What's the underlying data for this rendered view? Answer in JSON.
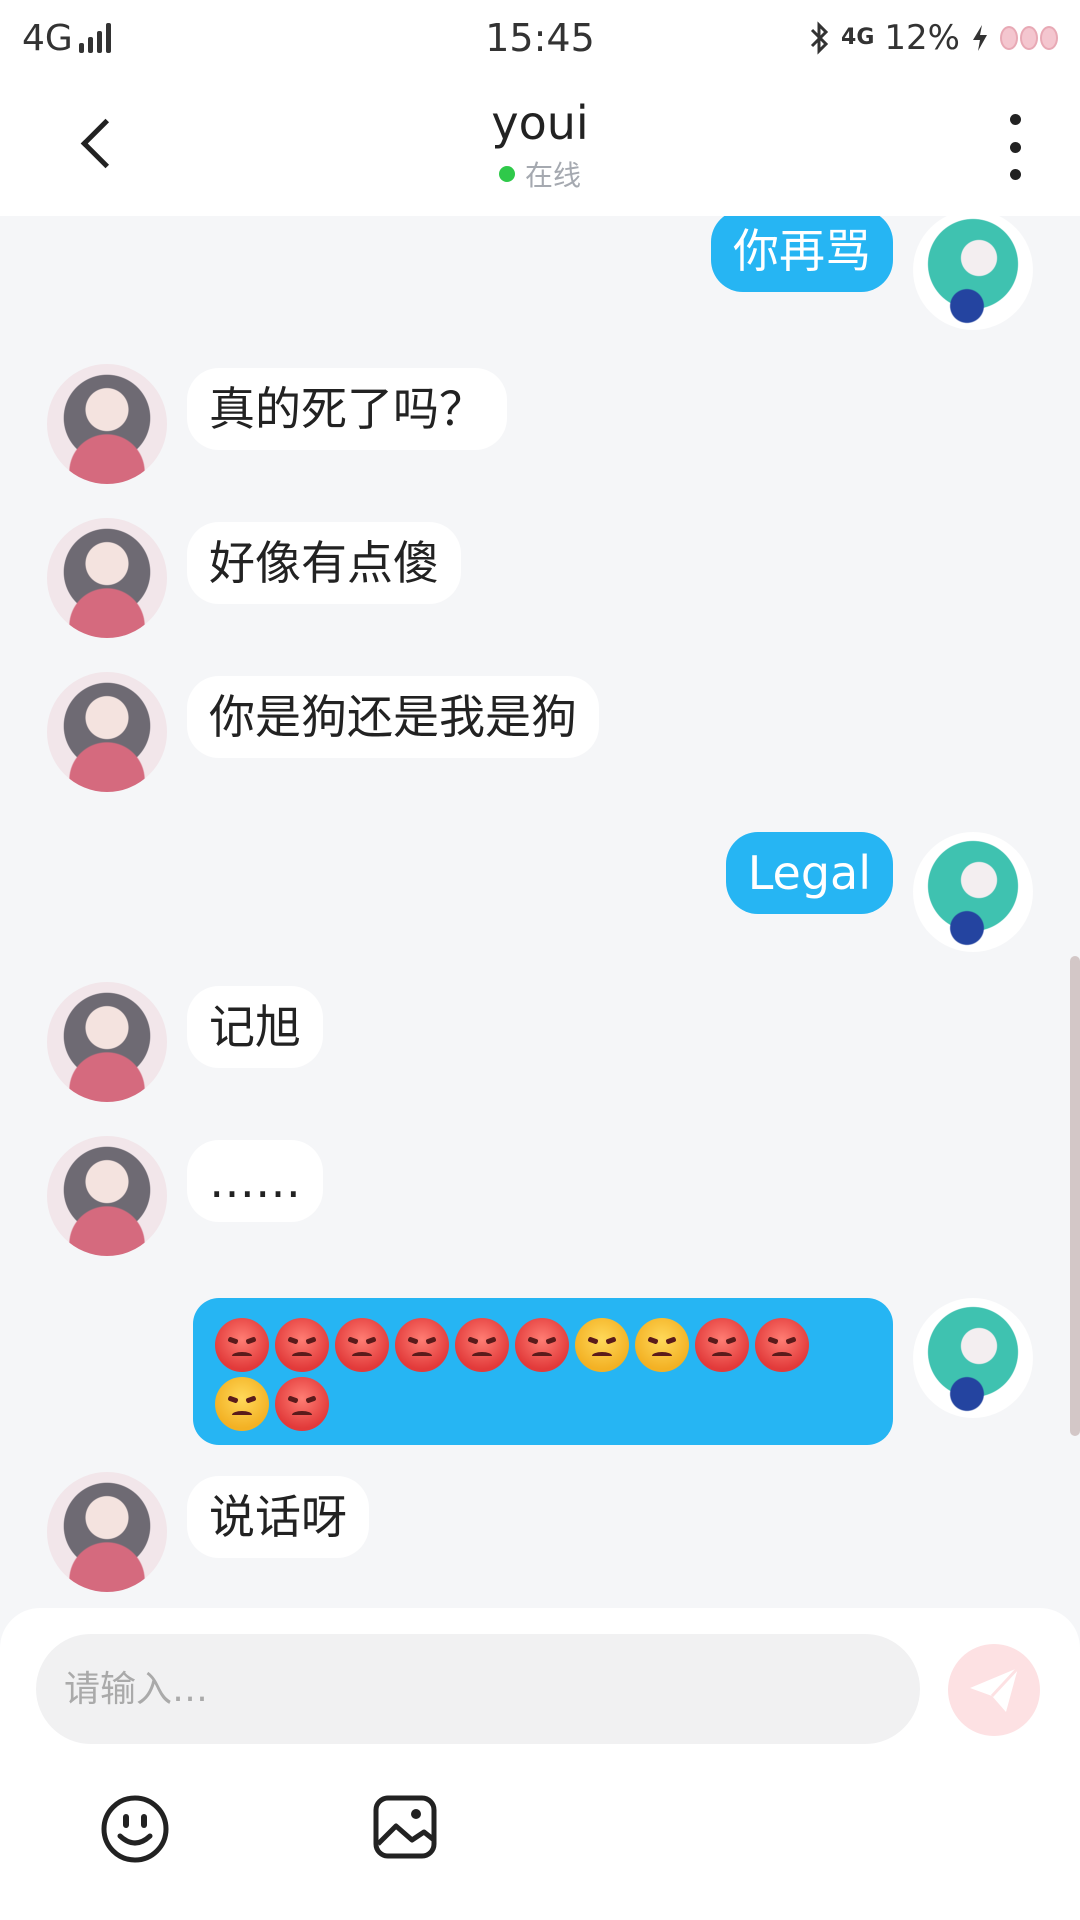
{
  "status_bar": {
    "network": "4G",
    "time": "15:45",
    "network2": "4G",
    "battery": "12%"
  },
  "header": {
    "title": "youi",
    "status": "在线"
  },
  "messages": [
    {
      "side": "me",
      "text": "你再骂"
    },
    {
      "side": "other",
      "text": "真的死了吗？"
    },
    {
      "side": "other",
      "text": "好像有点傻"
    },
    {
      "side": "other",
      "text": "你是狗还是我是狗"
    },
    {
      "side": "me",
      "text": "Legal"
    },
    {
      "side": "other",
      "text": "记旭"
    },
    {
      "side": "other",
      "text": "……"
    },
    {
      "side": "me",
      "text": "",
      "emojis": [
        "angry",
        "angry",
        "angry",
        "angry",
        "angry",
        "angry",
        "huffing",
        "huffing",
        "angry",
        "angry",
        "huffing",
        "angry"
      ]
    },
    {
      "side": "other",
      "text": "说话呀"
    }
  ],
  "input": {
    "placeholder": "请输入…"
  },
  "colors": {
    "accent": "#26b5f3",
    "online": "#2fc94a",
    "send": "#fde1e3"
  }
}
